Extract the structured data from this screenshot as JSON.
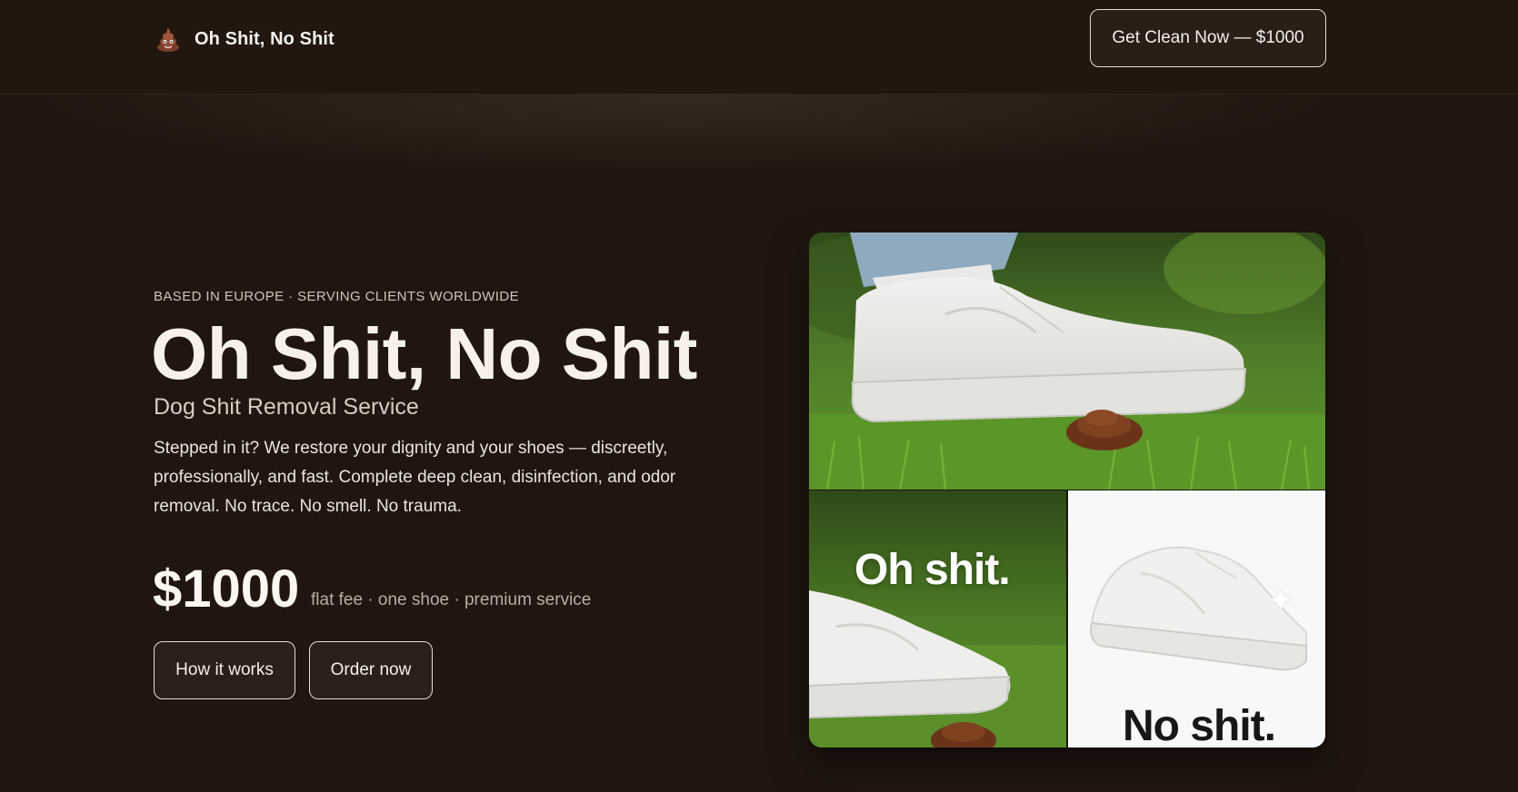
{
  "header": {
    "brand_name": "Oh Shit, No Shit",
    "brand_icon": "poop-emoji-icon",
    "cta_label": "Get Clean Now — $1000"
  },
  "hero": {
    "eyebrow": "BASED IN EUROPE · SERVING CLIENTS WORLDWIDE",
    "title": "Oh Shit, No Shit",
    "subtitle": "Dog Shit Removal Service",
    "description": "Stepped in it? We restore your dignity and your shoes — discreetly, professionally, and fast. Complete deep clean, disinfection, and odor removal. No trace. No smell. No trauma.",
    "price": "$1000",
    "price_note": "flat fee · one shoe · premium service",
    "buttons": {
      "how_it_works": "How it works",
      "order_now": "Order now"
    }
  },
  "collage": {
    "overlay_before": "Oh shit.",
    "overlay_after": "No shit."
  },
  "colors": {
    "background": "#21160f",
    "button_border": "#e8ddd1",
    "button_fill": "#2c1e18",
    "grass": "#4f8a2a"
  }
}
